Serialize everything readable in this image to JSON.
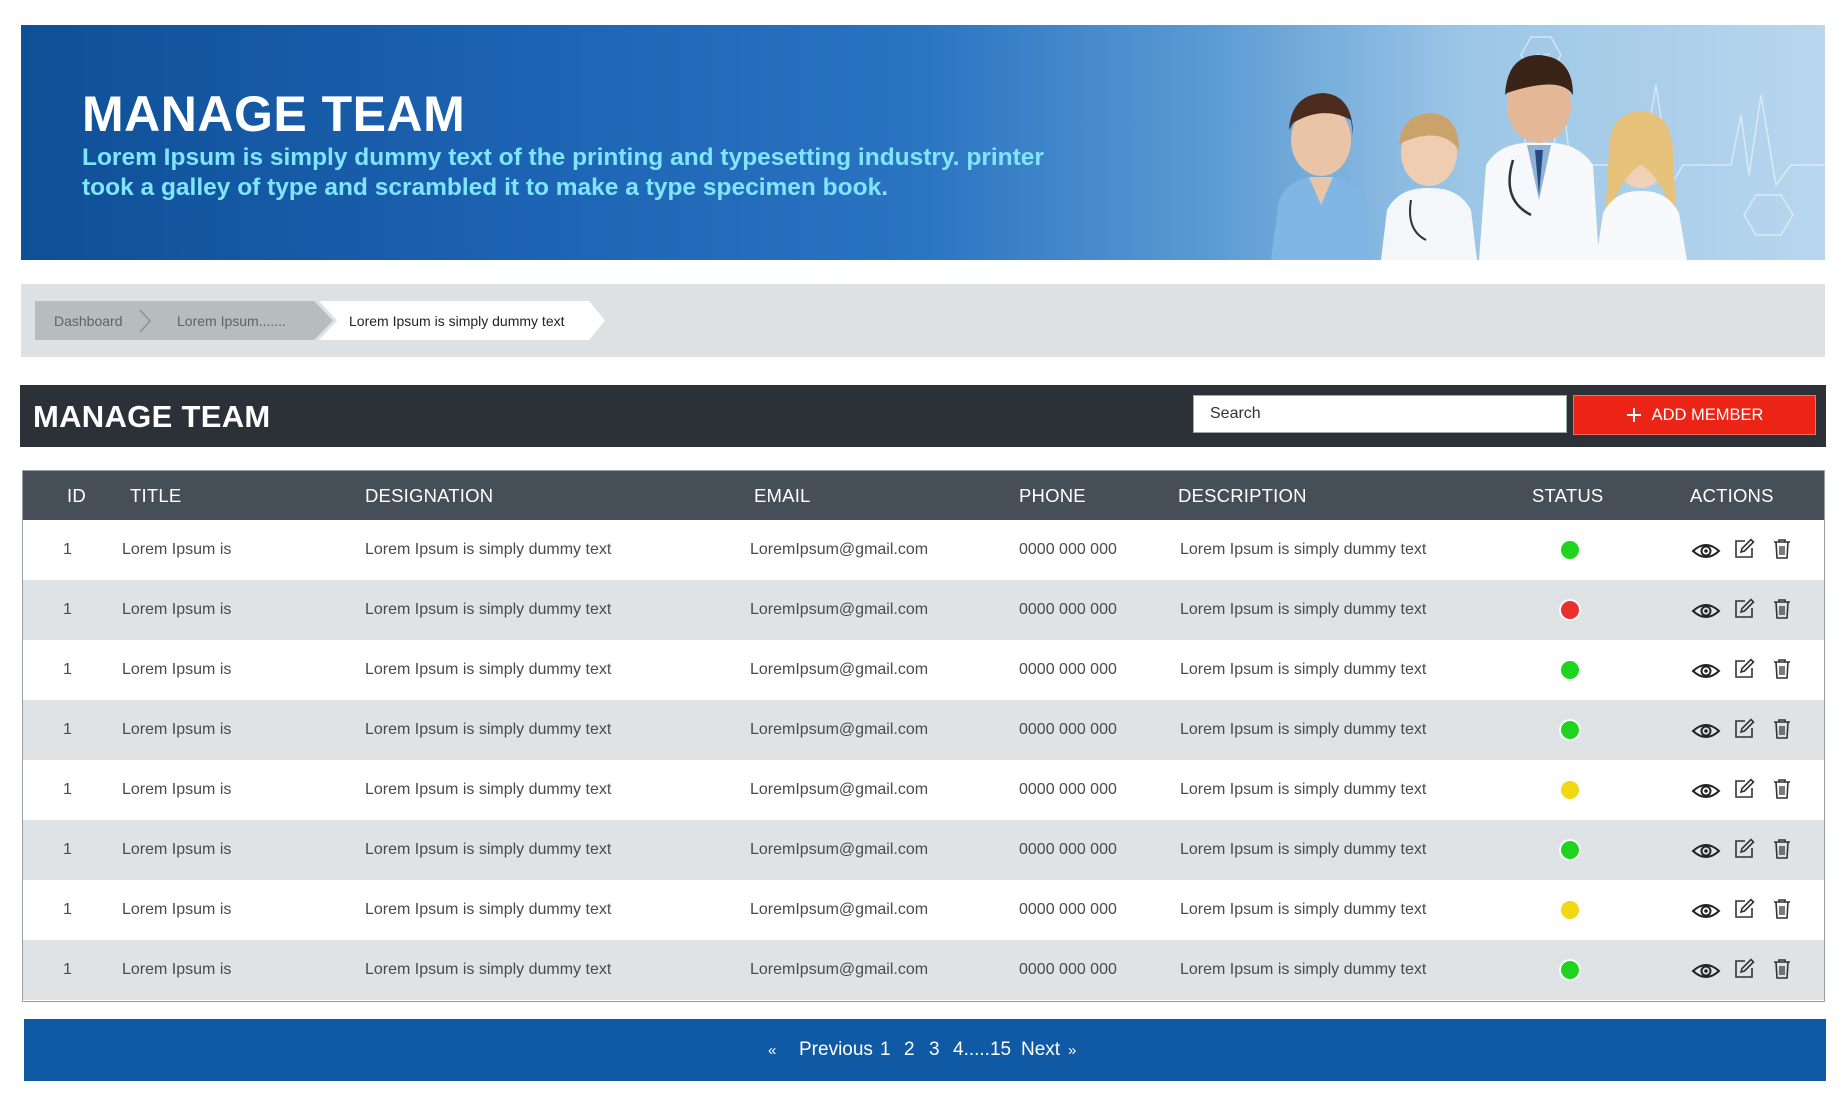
{
  "banner": {
    "title": "MANAGE TEAM",
    "subtitle": "Lorem Ipsum is simply dummy text of the printing and typesetting industry. printer took a galley of type and scrambled it to make a type specimen book."
  },
  "breadcrumb": {
    "items": [
      "Dashboard",
      "Lorem Ipsum.......",
      "Lorem Ipsum is simply dummy text"
    ]
  },
  "header": {
    "title": "MANAGE TEAM",
    "search_placeholder": "Search",
    "add_button_label": "ADD MEMBER"
  },
  "table": {
    "columns": [
      "ID",
      "TITLE",
      "DESIGNATION",
      "EMAIL",
      "PHONE",
      "DESCRIPTION",
      "STATUS",
      "ACTIONS"
    ],
    "rows": [
      {
        "id": "1",
        "title": "Lorem Ipsum is",
        "designation": "Lorem Ipsum is simply dummy text",
        "email": "LoremIpsum@gmail.com",
        "phone": "0000 000 000",
        "description": "Lorem Ipsum is simply dummy text",
        "status": "green"
      },
      {
        "id": "1",
        "title": "Lorem Ipsum is",
        "designation": "Lorem Ipsum is simply dummy text",
        "email": "LoremIpsum@gmail.com",
        "phone": "0000 000 000",
        "description": "Lorem Ipsum is simply dummy text",
        "status": "red"
      },
      {
        "id": "1",
        "title": "Lorem Ipsum is",
        "designation": "Lorem Ipsum is simply dummy text",
        "email": "LoremIpsum@gmail.com",
        "phone": "0000 000 000",
        "description": "Lorem Ipsum is simply dummy text",
        "status": "green"
      },
      {
        "id": "1",
        "title": "Lorem Ipsum is",
        "designation": "Lorem Ipsum is simply dummy text",
        "email": "LoremIpsum@gmail.com",
        "phone": "0000 000 000",
        "description": "Lorem Ipsum is simply dummy text",
        "status": "green"
      },
      {
        "id": "1",
        "title": "Lorem Ipsum is",
        "designation": "Lorem Ipsum is simply dummy text",
        "email": "LoremIpsum@gmail.com",
        "phone": "0000 000 000",
        "description": "Lorem Ipsum is simply dummy text",
        "status": "yellow"
      },
      {
        "id": "1",
        "title": "Lorem Ipsum is",
        "designation": "Lorem Ipsum is simply dummy text",
        "email": "LoremIpsum@gmail.com",
        "phone": "0000 000 000",
        "description": "Lorem Ipsum is simply dummy text",
        "status": "green"
      },
      {
        "id": "1",
        "title": "Lorem Ipsum is",
        "designation": "Lorem Ipsum is simply dummy text",
        "email": "LoremIpsum@gmail.com",
        "phone": "0000 000 000",
        "description": "Lorem Ipsum is simply dummy text",
        "status": "yellow"
      },
      {
        "id": "1",
        "title": "Lorem Ipsum is",
        "designation": "Lorem Ipsum is simply dummy text",
        "email": "LoremIpsum@gmail.com",
        "phone": "0000 000 000",
        "description": "Lorem Ipsum is simply dummy text",
        "status": "green"
      }
    ],
    "row_actions": [
      "eye-icon",
      "edit-icon",
      "trash-icon"
    ]
  },
  "status_colors": {
    "green": "#1fd41f",
    "red": "#e8302c",
    "yellow": "#f2d812"
  },
  "pagination": {
    "first": "«",
    "previous": "Previous",
    "pages": [
      "1",
      "2",
      "3",
      "4.....15"
    ],
    "next": "Next",
    "last": "»"
  },
  "colors": {
    "banner_blue": "#1d63b3",
    "header_dark": "#2b3137",
    "table_head": "#464f57",
    "accent_red": "#ec2415",
    "pager_blue": "#105aa5",
    "subtitle_cyan": "#7fe6ff"
  }
}
